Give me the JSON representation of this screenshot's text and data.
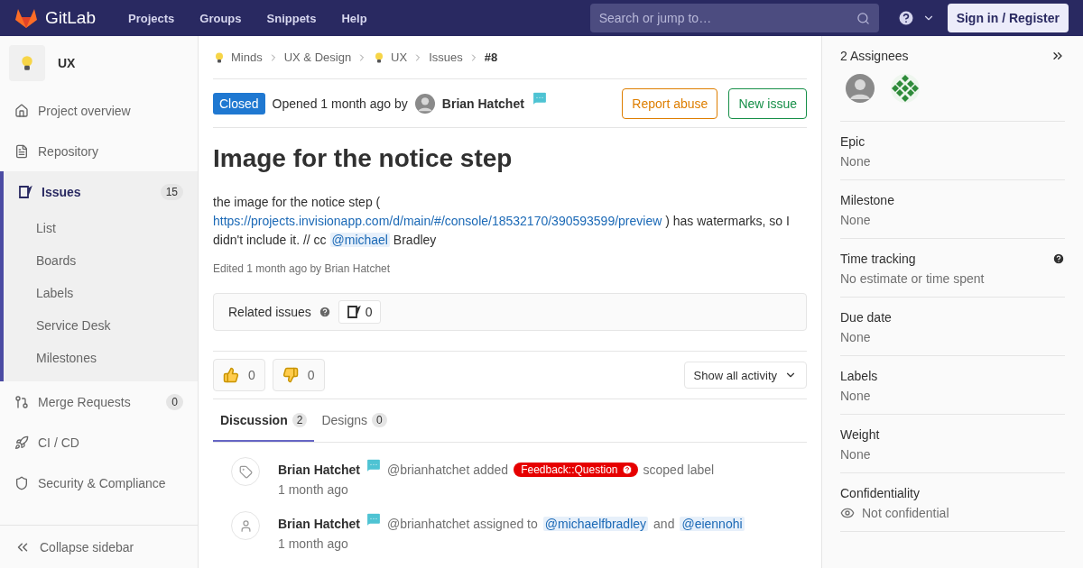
{
  "topbar": {
    "brand": "GitLab",
    "menu": [
      "Projects",
      "Groups",
      "Snippets",
      "Help"
    ],
    "search": {
      "placeholder": "Search or jump to…"
    },
    "sign_in": "Sign in / Register"
  },
  "sidebar": {
    "project": "UX",
    "items": [
      {
        "kind": "home",
        "label": "Project overview",
        "selected": false
      },
      {
        "kind": "file",
        "label": "Repository",
        "selected": false
      },
      {
        "kind": "issues",
        "label": "Issues",
        "count": "15",
        "selected": true,
        "children": [
          {
            "label": "List"
          },
          {
            "label": "Boards"
          },
          {
            "label": "Labels"
          },
          {
            "label": "Service Desk"
          },
          {
            "label": "Milestones"
          }
        ]
      },
      {
        "kind": "merge",
        "label": "Merge Requests",
        "count": "0",
        "selected": false
      },
      {
        "kind": "rocket",
        "label": "CI / CD",
        "selected": false
      },
      {
        "kind": "shield",
        "label": "Security & Compliance",
        "selected": false
      }
    ],
    "collapse": "Collapse sidebar"
  },
  "breadcrumbs": [
    {
      "label": "Minds",
      "icon": true
    },
    {
      "label": "UX & Design",
      "icon": false
    },
    {
      "label": "UX",
      "icon": true
    },
    {
      "label": "Issues",
      "icon": false
    },
    {
      "label": "#8",
      "icon": false,
      "current": true
    }
  ],
  "issue": {
    "status": "Closed",
    "opened": "Opened 1 month ago by",
    "author": "Brian Hatchet",
    "report": "Report abuse",
    "new_issue": "New issue",
    "title": "Image for the notice step",
    "description": [
      {
        "kind": "text",
        "text": "the image for the notice step ("
      },
      {
        "kind": "link",
        "text": "https://projects.invisionapp.com/d/main/#/console/18532170/390593599/preview"
      },
      {
        "kind": "text",
        "text": ") has watermarks, so I didn't include it. // cc"
      },
      {
        "kind": "mention",
        "text": "@michael"
      },
      {
        "kind": "text",
        "text": "Bradley"
      }
    ],
    "edited": "Edited 1 month ago by Brian Hatchet",
    "related": {
      "label": "Related issues",
      "count": "0"
    },
    "reactions": [
      {
        "kind": "up",
        "count": "0"
      },
      {
        "kind": "down",
        "count": "0"
      }
    ],
    "activity_filter": "Show all activity",
    "tabs": [
      {
        "label": "Discussion",
        "count": "2",
        "selected": true
      },
      {
        "label": "Designs",
        "count": "0",
        "selected": false
      }
    ],
    "notes": [
      {
        "kind": "label",
        "author": "Brian Hatchet",
        "time": "1 month ago",
        "parts": [
          {
            "kind": "text",
            "text": "@brianhatchet added"
          },
          {
            "kind": "scoped-label",
            "text": "Feedback::Question",
            "color": "#e60000"
          },
          {
            "kind": "text",
            "text": "scoped label"
          }
        ]
      },
      {
        "kind": "user",
        "author": "Brian Hatchet",
        "time": "1 month ago",
        "parts": [
          {
            "kind": "text",
            "text": "@brianhatchet assigned to"
          },
          {
            "kind": "mention",
            "text": "@michaelfbradley"
          },
          {
            "kind": "text",
            "text": "and"
          },
          {
            "kind": "mention",
            "text": "@eiennohi"
          }
        ]
      }
    ]
  },
  "right_sidebar": {
    "assignees": "2 Assignees",
    "avatars": [
      {
        "kind": "person"
      },
      {
        "kind": "identicon"
      }
    ],
    "fields": [
      {
        "label": "Epic",
        "value": "None"
      },
      {
        "label": "Milestone",
        "value": "None"
      },
      {
        "label": "Time tracking",
        "value": "No estimate or time spent",
        "help": true
      },
      {
        "label": "Due date",
        "value": "None"
      },
      {
        "label": "Labels",
        "value": "None"
      },
      {
        "label": "Weight",
        "value": "None"
      },
      {
        "label": "Confidentiality",
        "value": "Not confidential",
        "eye": true
      }
    ]
  }
}
